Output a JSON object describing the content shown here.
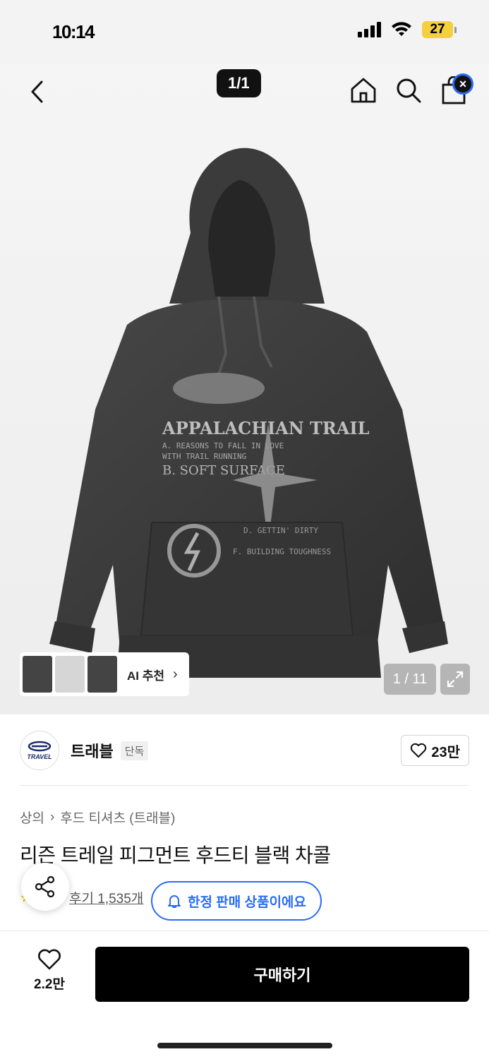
{
  "status": {
    "time": "10:14",
    "battery": "27"
  },
  "nav": {
    "back_icon": "chevron-left-icon",
    "image_position": "1/1",
    "home_icon": "home-icon",
    "search_icon": "search-icon",
    "cart_icon": "shopping-bag-icon",
    "cart_badge": "×"
  },
  "gallery": {
    "ai_recommend_label": "AI 추천",
    "image_counter": "1 / 11",
    "expand_icon": "expand-icon"
  },
  "brand": {
    "logo_text": "TRAVEL",
    "name": "트래블",
    "tag": "단독",
    "likes": "23만"
  },
  "product": {
    "breadcrumb": [
      "상의",
      "후드 티셔츠 (트래블)"
    ],
    "title": "리즌 트레일 피그먼트 후드티 블랙 차콜",
    "reviews": "후기 1,535개",
    "limited_notice": "한정 판매 상품이에요"
  },
  "bottom": {
    "wish_count": "2.2만",
    "buy_label": "구매하기"
  },
  "colors": {
    "accent_blue": "#2a6cf5",
    "buy_button": "#000000",
    "hoodie": "#3a3a3a"
  }
}
